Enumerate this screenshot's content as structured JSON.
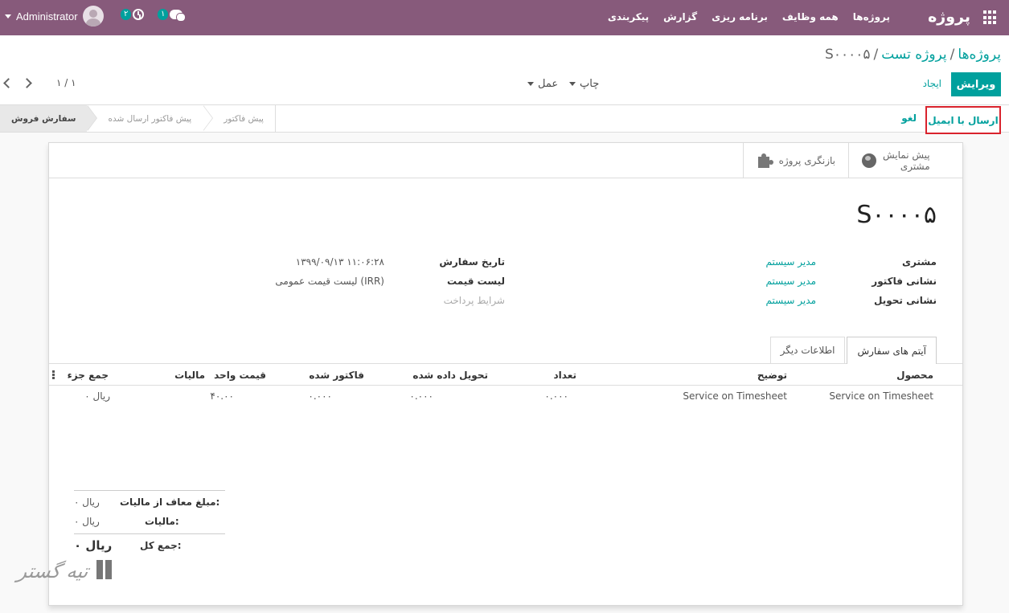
{
  "navbar": {
    "app_name": "پروژه",
    "menu": [
      "پروژه‌ها",
      "همه وظایف",
      "برنامه ریزی",
      "گزارش",
      "پیکربندی"
    ],
    "user": "Administrator",
    "activity_count": "۲",
    "message_count": "۱",
    "color": "#875a7b"
  },
  "breadcrumb": {
    "root": "پروژه‌ها",
    "project": "پروژه تست",
    "current": "S۰۰۰۰۵"
  },
  "control": {
    "edit_label": "ویرایش",
    "create_label": "ایجاد",
    "print_label": "چاپ",
    "action_label": "عمل",
    "pager": "۱ / ۱"
  },
  "statusbar": {
    "send_email_label": "ارسال با ایمیل",
    "cancel_label": "لغو",
    "stages": [
      "سفارش فروش",
      "پیش فاکتور ارسال شده",
      "پیش فاکتور"
    ],
    "active_stage": "سفارش فروش"
  },
  "smart_buttons": {
    "preview_line1": "پیش نمایش",
    "preview_line2": "مشتری",
    "project_overview": "بازنگری پروژه"
  },
  "record": {
    "name": "S۰۰۰۰۵",
    "customer_label": "مشتری",
    "customer": "مدیر سیستم",
    "invoice_address_label": "نشانی فاکتور",
    "invoice_address": "مدیر سیستم",
    "delivery_address_label": "نشانی تحویل",
    "delivery_address": "مدیر سیستم",
    "order_date_label": "تاریخ سفارش",
    "order_date": "۱۳۹۹/۰۹/۱۳ ۱۱:۰۶:۲۸",
    "pricelist_label": "لیست قیمت",
    "pricelist": "لیست قیمت عمومی (IRR)",
    "payment_terms_label": "شرایط پرداخت"
  },
  "tabs": {
    "order_lines": "آیتم های سفارش",
    "other_info": "اطلاعات دیگر"
  },
  "table": {
    "headers": {
      "product": "محصول",
      "description": "توضیح",
      "quantity": "تعداد",
      "delivered": "تحویل داده شده",
      "invoiced": "فاکتور شده",
      "unit_price": "قیمت واحد",
      "taxes": "مالیات",
      "subtotal": "جمع جزء"
    },
    "rows": [
      {
        "product": "Service on Timesheet",
        "description": "Service on Timesheet",
        "quantity": "۰.۰۰۰",
        "delivered": "۰.۰۰۰",
        "invoiced": "۰.۰۰۰",
        "unit_price": "۴۰.۰۰",
        "taxes": "",
        "subtotal": "۰ ریال"
      }
    ]
  },
  "totals": {
    "untaxed_label": "مبلغ معاف از مالیات:",
    "untaxed": "۰ ریال",
    "tax_label": "مالیات:",
    "tax": "۰ ریال",
    "total_label": "جمع کل:",
    "total": "۰ ریال"
  },
  "watermark": {
    "text": "تیه گستر"
  }
}
